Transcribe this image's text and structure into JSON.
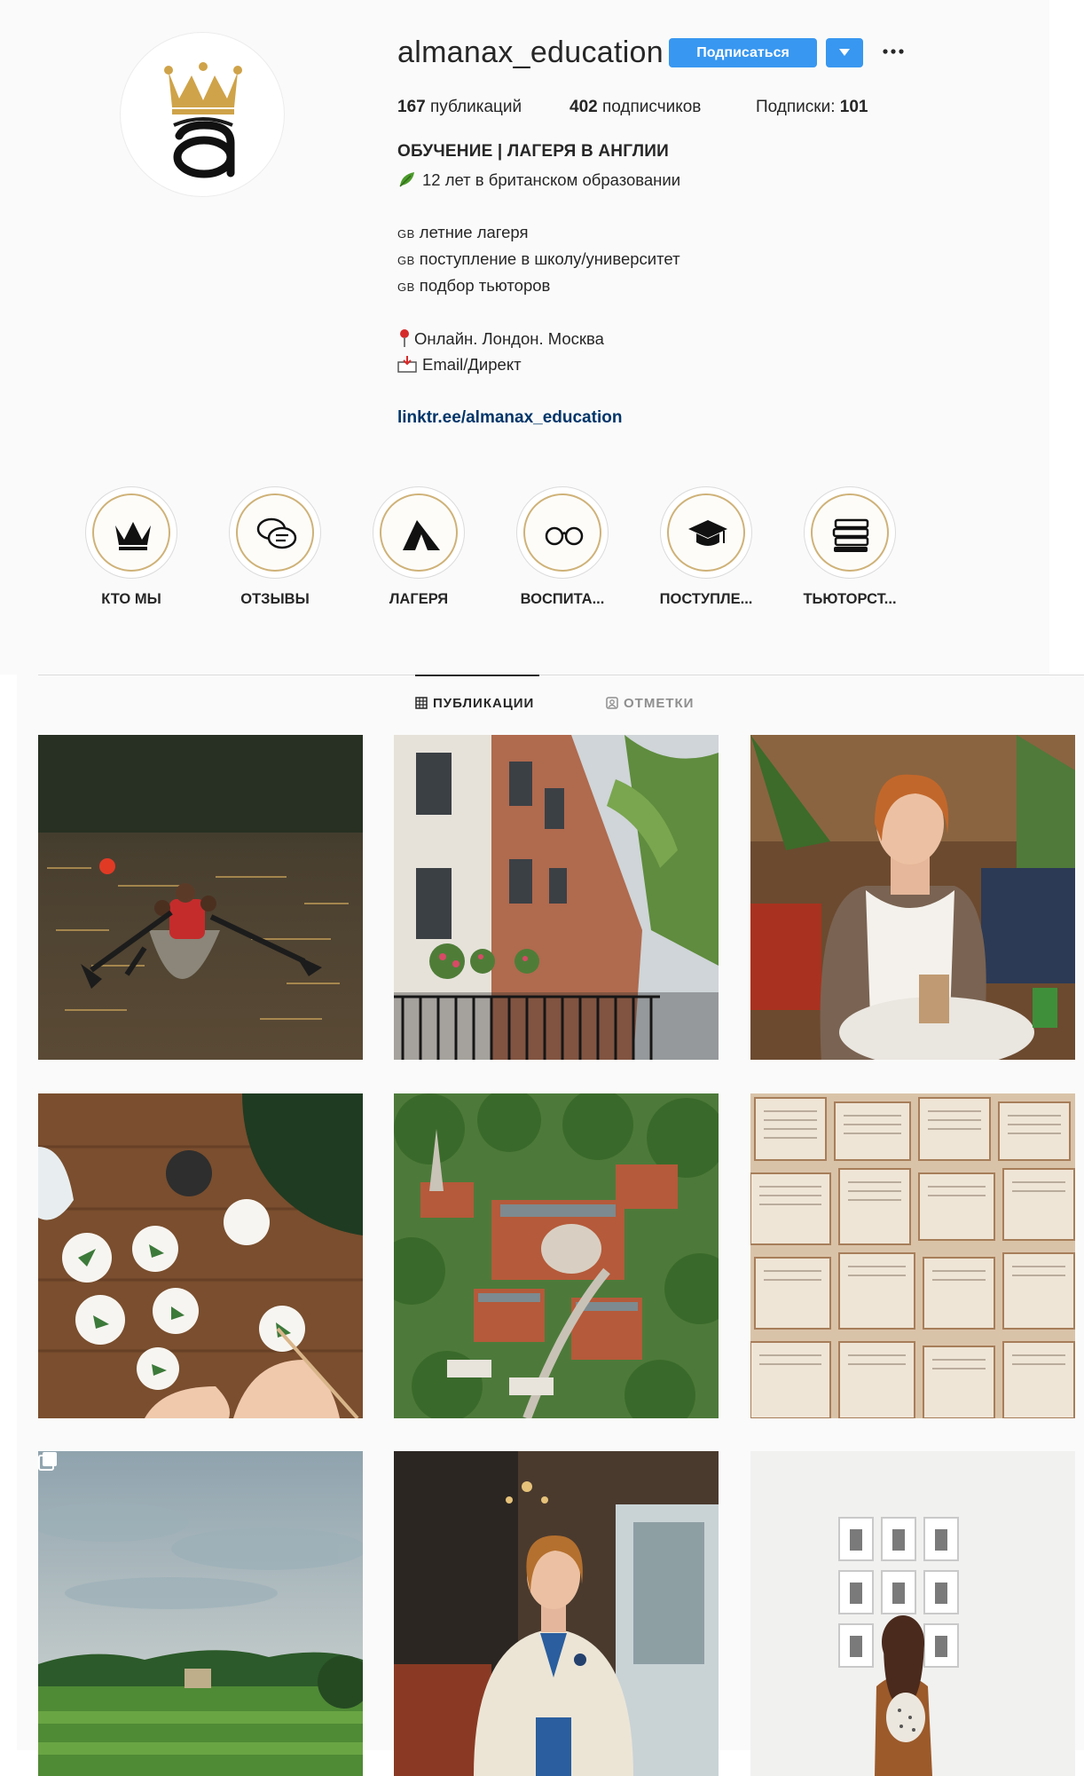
{
  "profile": {
    "username": "almanax_education",
    "follow_label": "Подписаться",
    "stats": {
      "posts_count": "167",
      "posts_label": "публикаций",
      "followers_count": "402",
      "followers_label": "подписчиков",
      "following_label": "Подписки:",
      "following_count": "101"
    },
    "bio": {
      "name": "ОБУЧЕНИЕ | ЛАГЕРЯ В АНГЛИИ",
      "line1": "12 лет в британском образовании",
      "flag_text": "GB",
      "service1": "летние лагеря",
      "service2": "поступление в школу/университет",
      "service3": "подбор тьюторов",
      "location": "Онлайн. Лондон. Москва",
      "contact": "Email/Директ",
      "link": "linktr.ee/almanax_education"
    }
  },
  "highlights": [
    {
      "label": "КТО МЫ",
      "icon": "crown-icon"
    },
    {
      "label": "ОТЗЫВЫ",
      "icon": "chat-bubbles-icon"
    },
    {
      "label": "ЛАГЕРЯ",
      "icon": "tent-icon"
    },
    {
      "label": "ВОСПИТА...",
      "icon": "glasses-icon"
    },
    {
      "label": "ПОСТУПЛЕ...",
      "icon": "graduation-cap-icon"
    },
    {
      "label": "ТЬЮТОРСТ...",
      "icon": "books-icon"
    }
  ],
  "tabs": {
    "posts": "ПУБЛИКАЦИИ",
    "tagged": "ОТМЕТКИ"
  },
  "posts": [
    {
      "subject": "canoe-on-lake-photo"
    },
    {
      "subject": "london-street-photo"
    },
    {
      "subject": "woman-in-cafe-photo"
    },
    {
      "subject": "botanical-craft-photo"
    },
    {
      "subject": "aerial-school-campus-photo"
    },
    {
      "subject": "open-books-photo"
    },
    {
      "subject": "park-lawn-landscape-photo"
    },
    {
      "subject": "woman-in-blazer-photo"
    },
    {
      "subject": "gallery-visitor-photo"
    }
  ],
  "colors": {
    "accent_blue": "#3897f0",
    "link": "#003569",
    "highlight_gold": "#cfb278",
    "background": "#fafafa"
  }
}
